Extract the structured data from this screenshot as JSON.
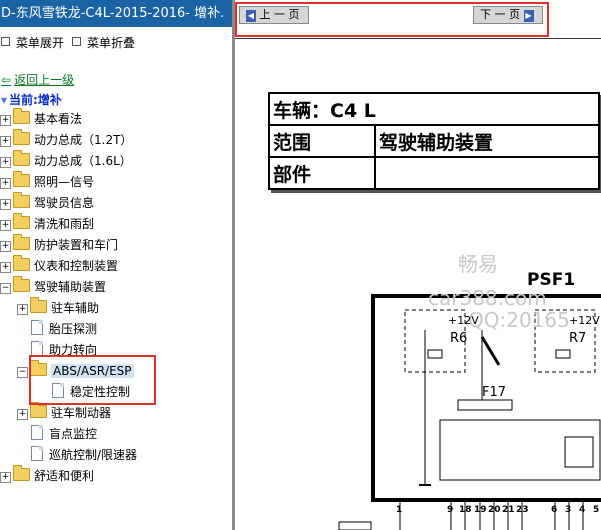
{
  "window_title": "D-东风雪铁龙-C4L-2015-2016- 增补.",
  "toolbar": {
    "expand_menu": "菜单展开",
    "collapse_menu": "菜单折叠"
  },
  "back_link": "返回上一级",
  "current": "当前:增补",
  "tree": {
    "items": [
      "基本看法",
      "动力总成（1.2T）",
      "动力总成（1.6L）",
      "照明—信号",
      "驾驶员信息",
      "清洗和雨刮",
      "防护装置和车门",
      "仪表和控制装置",
      "驾驶辅助装置"
    ],
    "sub": [
      "驻车辅助",
      "胎压探测",
      "助力转向",
      "ABS/ASR/ESP",
      "稳定性控制",
      "驻车制动器",
      "盲点监控",
      "巡航控制/限速器"
    ],
    "last": "舒适和便利"
  },
  "nav": {
    "prev": "上 一 页",
    "next": "下 一 页"
  },
  "doc": {
    "vehicle_label": "车辆：C4 L",
    "scope_label": "范围",
    "scope_value": "驾驶辅助装置",
    "part_label": "部件",
    "part_value": "",
    "watermark1": "畅易",
    "watermark2": "car388.com",
    "watermark3": "QQ:20165",
    "diagram_title": "PSF1",
    "v1": "+12V",
    "v2": "+12V",
    "relay1": "R6",
    "relay2": "R7",
    "fuse": "F17",
    "pins": [
      "1",
      "9",
      "18",
      "19",
      "20",
      "21",
      "23",
      "6",
      "3",
      "4",
      "5"
    ]
  }
}
